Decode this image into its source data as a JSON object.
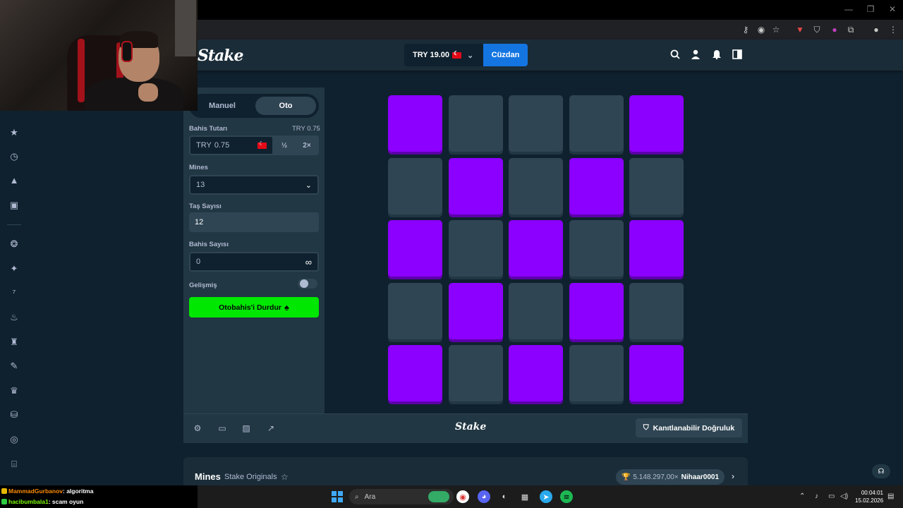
{
  "browser": {
    "window_controls": [
      "—",
      "❐",
      "✕"
    ],
    "extensions": [
      "key-icon",
      "eye-off-icon",
      "star-icon",
      "ext-icon",
      "shield-icon",
      "ext2-icon",
      "puzzle-icon",
      "profile-icon",
      "menu-icon"
    ]
  },
  "header": {
    "logo": "Stake",
    "balance": "TRY 19.00",
    "wallet_label": "Cüzdan"
  },
  "controls": {
    "tab_manual": "Manuel",
    "tab_auto": "Oto",
    "bet_amount_label": "Bahis Tutarı",
    "bet_amount_value_right": "TRY 0.75",
    "bet_currency": "TRY",
    "bet_value": "0.75",
    "half_label": "½",
    "double_label": "2×",
    "mines_label": "Mines",
    "mines_value": "13",
    "gems_label": "Taş Sayısı",
    "gems_value": "12",
    "bets_label": "Bahis Sayısı",
    "bets_value": "0",
    "advanced_label": "Gelişmiş",
    "stop_button": "Otobahis'i Durdur"
  },
  "board": {
    "grid": [
      [
        "gem",
        "gray",
        "gray",
        "gray",
        "gem"
      ],
      [
        "gray",
        "gem",
        "gray",
        "gem",
        "gray"
      ],
      [
        "gem",
        "gray",
        "gem",
        "gray",
        "gem"
      ],
      [
        "gray",
        "gem",
        "gray",
        "gem",
        "gray"
      ],
      [
        "gem",
        "gray",
        "gem",
        "gray",
        "gem"
      ]
    ]
  },
  "footer": {
    "logo": "Stake",
    "fair_button": "Kanıtlanabilir Doğruluk"
  },
  "game_info": {
    "title": "Mines",
    "subtitle": "Stake Originals",
    "record_value": "5.148.297,00×",
    "record_user": "Nihaar0001"
  },
  "chat": [
    {
      "user": "MammadGurbanov",
      "message": ": algoritma"
    },
    {
      "user": "hacibumbala1",
      "message": ": scam oyun"
    }
  ],
  "taskbar": {
    "search_placeholder": "Ara",
    "time": "00:04:01",
    "date": "15.02.2026"
  }
}
